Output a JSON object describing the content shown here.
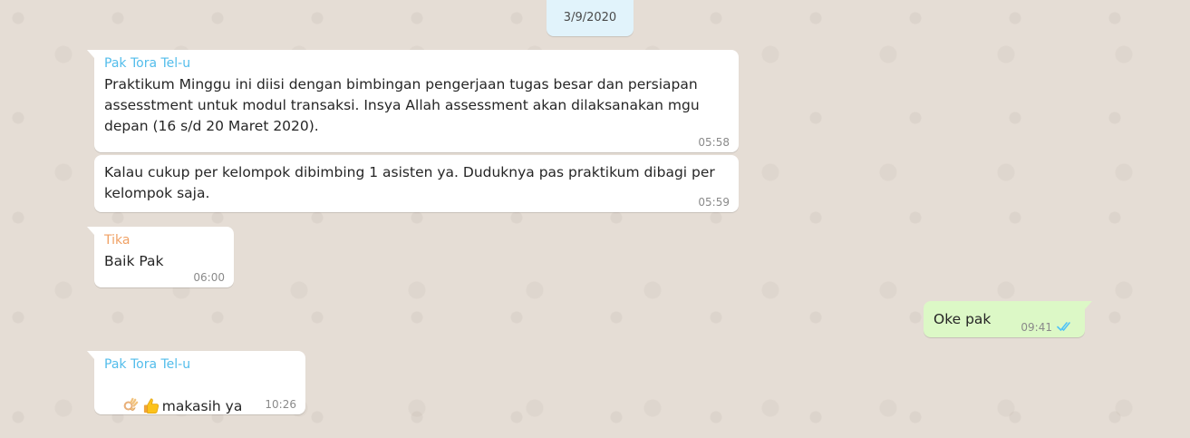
{
  "date_badge": "3/9/2020",
  "messages": [
    {
      "sender": "Pak Tora Tel-u",
      "text": "Praktikum Minggu ini diisi dengan bimbingan pengerjaan tugas besar dan persiapan\nassesstment untuk modul transaksi. Insya Allah assessment akan dilaksanakan mgu\ndepan (16 s/d 20 Maret 2020).",
      "time": "05:58"
    },
    {
      "text": "Kalau cukup per kelompok dibimbing 1 asisten ya. Duduknya pas praktikum dibagi per\nkelompok saja.",
      "time": "05:59"
    },
    {
      "sender": "Tika",
      "text": "Baik Pak",
      "time": "06:00"
    },
    {
      "text": "Oke pak",
      "time": "09:41",
      "status": "read",
      "status_icon": "double-check-icon",
      "status_color": "#4fc3f7"
    },
    {
      "sender": "Pak Tora Tel-u",
      "emoji": [
        "ok-hand-emoji",
        "thumbs-up-emoji"
      ],
      "text": "makasih ya",
      "time": "10:26"
    }
  ],
  "colors": {
    "background": "#e5ddd5",
    "incoming_bubble": "#ffffff",
    "outgoing_bubble": "#dcf8c6",
    "date_badge": "#e1f3fb",
    "sender_pak_tora": "#53bdeb",
    "sender_tika": "#f0a165"
  }
}
